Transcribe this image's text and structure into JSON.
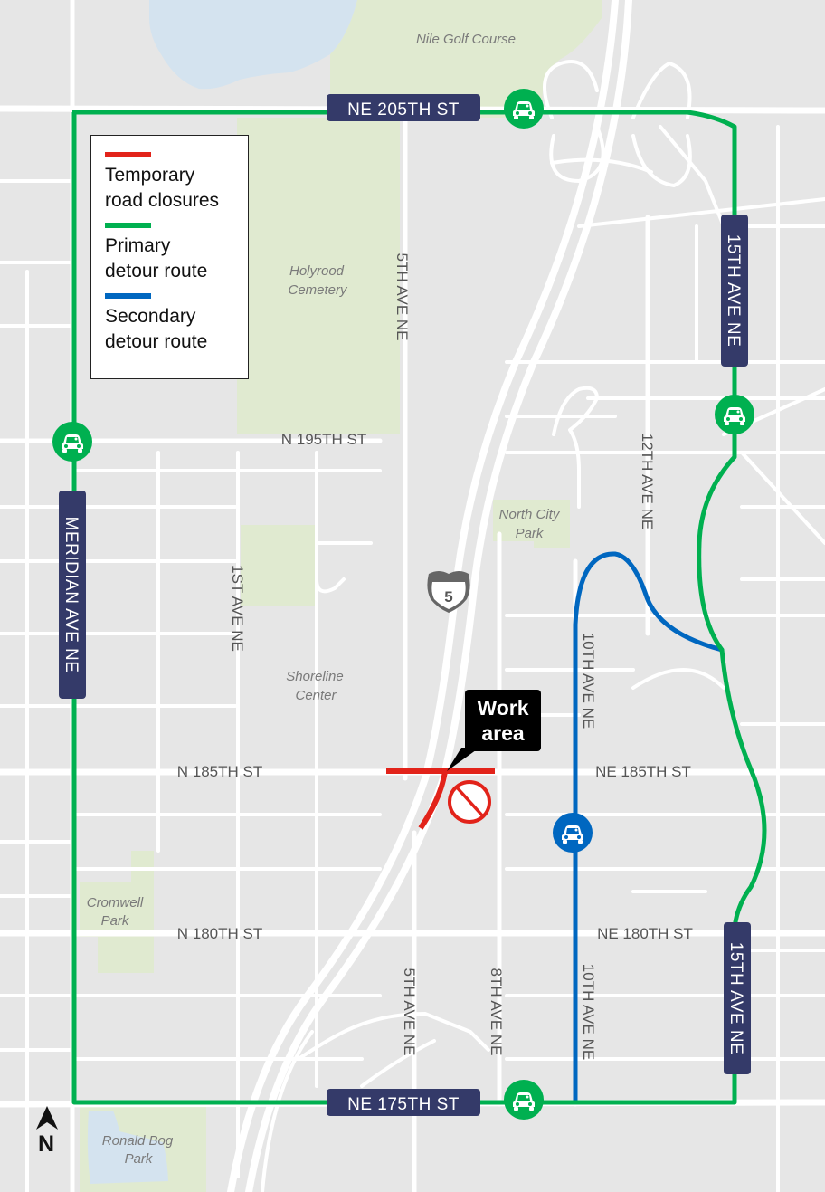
{
  "map": {
    "colors": {
      "background": "#e6e6e6",
      "road": "#ffffff",
      "park": "#e0ead0",
      "water": "#d4e3ef",
      "closure": "#e2231a",
      "primary_detour": "#00b050",
      "secondary_detour": "#0067c0",
      "street_shield": "#343a69",
      "callout": "#000000"
    },
    "legend": {
      "items": [
        {
          "label": "Temporary\nroad closures",
          "color": "#e2231a"
        },
        {
          "label": "Primary\ndetour route",
          "color": "#00b050"
        },
        {
          "label": "Secondary\ndetour route",
          "color": "#0067c0"
        }
      ]
    },
    "route_shields": {
      "ne205": "NE 205TH ST",
      "ne175": "NE 175TH ST",
      "fifteenth_north": "15TH AVE NE",
      "fifteenth_south": "15TH AVE NE",
      "meridian": "MERIDIAN AVE NE"
    },
    "street_labels": {
      "n195": "N 195TH  ST",
      "n185": "N 185TH  ST",
      "ne185": "NE 185TH  ST",
      "n180": "N 180TH  ST",
      "ne180": "NE 180TH  ST",
      "fifth_north": "5TH AVE NE",
      "fifth_south": "5TH AVE NE",
      "eighth": "8TH AVE NE",
      "tenth_north": "10TH AVE NE",
      "tenth_south": "10TH AVE NE",
      "twelfth": "12TH AVE NE",
      "first": "1ST AVE NE"
    },
    "place_labels": {
      "nile_golf": "Nile Golf Course",
      "holyrood_1": "Holyrood",
      "holyrood_2": "Cemetery",
      "north_city_1": "North City",
      "north_city_2": "Park",
      "shoreline_1": "Shoreline",
      "shoreline_2": "Center",
      "cromwell_1": "Cromwell",
      "cromwell_2": "Park",
      "ronald_1": "Ronald Bog",
      "ronald_2": "Park"
    },
    "interstate": {
      "number": "5"
    },
    "callout": {
      "text": "Work\narea"
    },
    "north_arrow": {
      "letter": "N"
    },
    "detour_markers": [
      {
        "route": "primary",
        "icon": "car-icon"
      },
      {
        "route": "primary",
        "icon": "car-icon"
      },
      {
        "route": "primary",
        "icon": "car-icon"
      },
      {
        "route": "primary",
        "icon": "car-icon"
      },
      {
        "route": "secondary",
        "icon": "car-icon"
      }
    ],
    "no_vehicles": {
      "icon": "no-cars-icon"
    }
  }
}
